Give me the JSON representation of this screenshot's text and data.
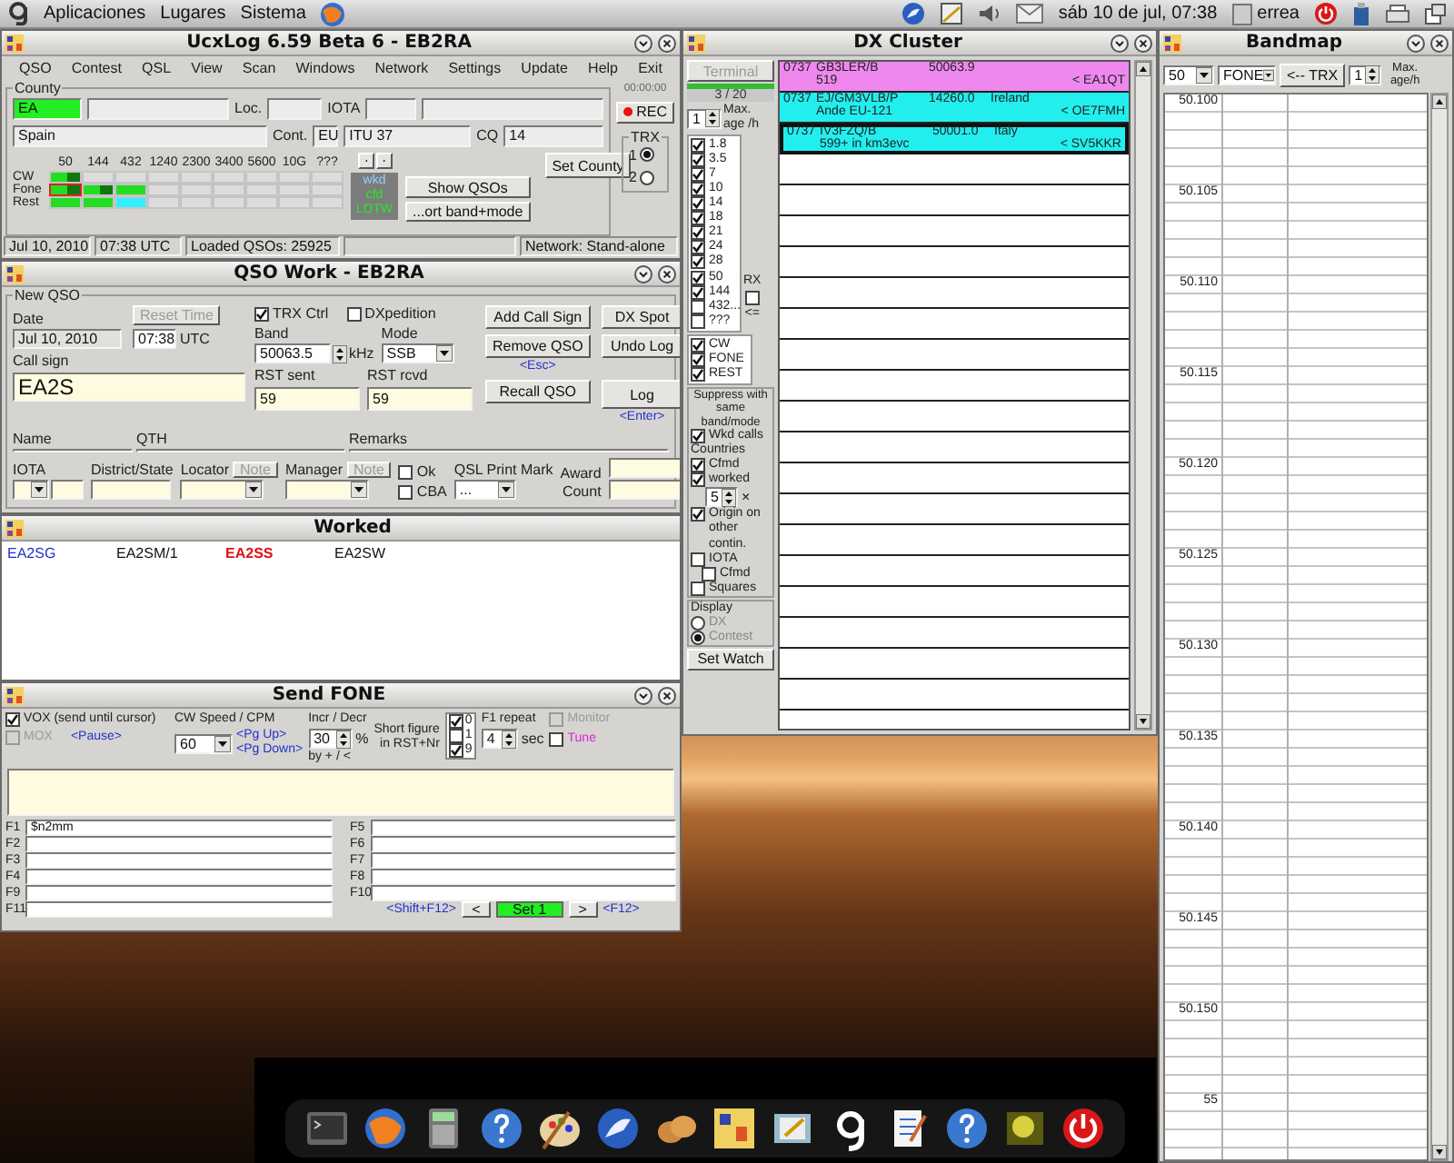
{
  "top_panel": {
    "menus": [
      "Aplicaciones",
      "Lugares",
      "Sistema"
    ],
    "clock": "sáb 10 de jul, 07:38",
    "user": "errea"
  },
  "main_window": {
    "title": "UcxLog 6.59 Beta 6 - EB2RA",
    "menu": [
      "QSO",
      "Contest",
      "QSL",
      "View",
      "Scan",
      "Windows",
      "Network",
      "Settings",
      "Update",
      "Help",
      "Exit"
    ],
    "country_group": {
      "legend": "County",
      "prefix": "EA",
      "loc_label": "Loc.",
      "iota_label": "IOTA",
      "country": "Spain",
      "cont_label": "Cont.",
      "cont": "EU",
      "itu": "ITU 37",
      "cq_label": "CQ",
      "cq": "14"
    },
    "band_grid": {
      "bands": [
        "50",
        "144",
        "432",
        "1240",
        "2300",
        "3400",
        "5600",
        "10G",
        "???"
      ],
      "rows": [
        {
          "mode": "CW",
          "cells": [
            {
              "kind": "both",
              "selected": false
            },
            {
              "kind": "none",
              "selected": false
            },
            {
              "kind": "none",
              "selected": false
            },
            {
              "kind": "none",
              "selected": false
            },
            {
              "kind": "none",
              "selected": false
            },
            {
              "kind": "none",
              "selected": false
            },
            {
              "kind": "none",
              "selected": false
            },
            {
              "kind": "none",
              "selected": false
            },
            {
              "kind": "none",
              "selected": false
            }
          ]
        },
        {
          "mode": "Fone",
          "cells": [
            {
              "kind": "both",
              "selected": true
            },
            {
              "kind": "both",
              "selected": false
            },
            {
              "kind": "cfm",
              "selected": false
            },
            {
              "kind": "none",
              "selected": false
            },
            {
              "kind": "none",
              "selected": false
            },
            {
              "kind": "none",
              "selected": false
            },
            {
              "kind": "none",
              "selected": false
            },
            {
              "kind": "none",
              "selected": false
            },
            {
              "kind": "none",
              "selected": false
            }
          ]
        },
        {
          "mode": "Rest",
          "cells": [
            {
              "kind": "cfm",
              "selected": false
            },
            {
              "kind": "cfm",
              "selected": false
            },
            {
              "kind": "lotw",
              "selected": false
            },
            {
              "kind": "none",
              "selected": false
            },
            {
              "kind": "none",
              "selected": false
            },
            {
              "kind": "none",
              "selected": false
            },
            {
              "kind": "none",
              "selected": false
            },
            {
              "kind": "none",
              "selected": false
            },
            {
              "kind": "none",
              "selected": false
            }
          ]
        }
      ]
    },
    "legend_box": [
      "wkd",
      "cfd",
      "LOTW"
    ],
    "set_country": "Set County",
    "show_qsos": "Show QSOs",
    "sort": "...ort band+mode",
    "timer": "00:00:00",
    "rec": "REC",
    "trx": {
      "label": "TRX",
      "options": [
        {
          "label": "1",
          "selected": true
        },
        {
          "label": "2",
          "selected": false
        }
      ]
    },
    "status_bar": [
      "Jul 10, 2010",
      "07:38 UTC",
      "Loaded QSOs: 25925",
      "Network: Stand-alone"
    ]
  },
  "qso_work": {
    "title": "QSO Work - EB2RA",
    "group": "New QSO",
    "date_label": "Date",
    "date": "Jul 10, 2010",
    "reset_time": {
      "label": "Reset Time",
      "disabled": true
    },
    "time": "07:38",
    "utc": "UTC",
    "trx_ctrl": {
      "label": "TRX Ctrl",
      "checked": true
    },
    "dxpedition": {
      "label": "DXpedition",
      "checked": false
    },
    "band_label": "Band",
    "band": "50063.5",
    "khz": "kHz",
    "mode_label": "Mode",
    "mode": "SSB",
    "callsign_label": "Call sign",
    "callsign": "EA2S",
    "rst_sent_label": "RST sent",
    "rst_sent": "59",
    "rst_rcvd_label": "RST rcvd",
    "rst_rcvd": "59",
    "buttons": [
      "Add Call Sign",
      "DX Spot",
      "Remove QSO",
      "Undo Log",
      "Recall QSO",
      "Log"
    ],
    "esc_hint": "<Esc>",
    "enter_hint": "<Enter>",
    "name_label": "Name",
    "qth_label": "QTH",
    "remarks_label": "Remarks",
    "iota_label": "IOTA",
    "district_label": "District/State",
    "locator_label": "Locator",
    "manager_label": "Manager",
    "locator_note": "Note",
    "manager_note": "Note",
    "ok": {
      "label": "Ok",
      "checked": false
    },
    "cba": {
      "label": "CBA",
      "checked": false
    },
    "qsl_label": "QSL Print Mark",
    "qsl_value": "...",
    "award_label": "Award",
    "count_label": "Count"
  },
  "worked": {
    "title": "Worked",
    "calls": [
      {
        "call": "EA2SG",
        "color": "#2233cc",
        "bold": false
      },
      {
        "call": "EA2SM/1",
        "color": "#111111",
        "bold": false
      },
      {
        "call": "EA2SS",
        "color": "#dd1111",
        "bold": true
      },
      {
        "call": "EA2SW",
        "color": "#111111",
        "bold": false
      }
    ]
  },
  "send_fone": {
    "title": "Send FONE",
    "vox": {
      "label": "VOX (send until cursor)",
      "checked": true
    },
    "pause": "<Pause>",
    "mox": {
      "label": "MOX",
      "checked": false,
      "disabled": true
    },
    "cw_speed_label": "CW Speed / CPM",
    "cw_speed": "60",
    "pg_up": "<Pg Up>",
    "pg_down": "<Pg Down>",
    "incr_label": "Incr / Decr",
    "incr": "30",
    "percent": "%",
    "incr_hint": "by + / <",
    "short_label": "Short figure",
    "short_label_2": "in RST+Nr",
    "short_figures": [
      {
        "label": "0",
        "checked": true
      },
      {
        "label": "1",
        "checked": false
      },
      {
        "label": "9",
        "checked": true
      }
    ],
    "repeat_label": "F1 repeat",
    "repeat": "4",
    "sec": "sec",
    "monitor": {
      "label": "Monitor",
      "checked": false,
      "disabled": true
    },
    "tune": {
      "label": "Tune",
      "checked": false
    },
    "fkeys": [
      {
        "key": "F1",
        "value": "$n2mm"
      },
      {
        "key": "F5"
      },
      {
        "key": "F2"
      },
      {
        "key": "F6"
      },
      {
        "key": "F3"
      },
      {
        "key": "F7"
      },
      {
        "key": "F4"
      },
      {
        "key": "F8"
      },
      {
        "key": "F9"
      },
      {
        "key": "F10"
      },
      {
        "key": "F11"
      }
    ],
    "prev_hint": "<Shift+F12>",
    "prev": "<",
    "set": "Set 1",
    "next": ">",
    "next_hint": "<F12>"
  },
  "dx_cluster": {
    "title": "DX Cluster",
    "terminal": {
      "label": "Terminal",
      "disabled": true
    },
    "count": "3 / 20",
    "max_age": "1",
    "max_age_label": "Max. age /h",
    "bands": [
      {
        "label": "1.8",
        "checked": true
      },
      {
        "label": "3.5",
        "checked": true
      },
      {
        "label": "7",
        "checked": true
      },
      {
        "label": "10",
        "checked": true
      },
      {
        "label": "14",
        "checked": true
      },
      {
        "label": "18",
        "checked": true
      },
      {
        "label": "21",
        "checked": true
      },
      {
        "label": "24",
        "checked": true
      },
      {
        "label": "28",
        "checked": true
      },
      {
        "label": "50",
        "checked": true
      },
      {
        "label": "144",
        "checked": true
      },
      {
        "label": "432...",
        "checked": false
      },
      {
        "label": "???",
        "checked": false
      }
    ],
    "rx_label": "RX",
    "rx_checked": false,
    "rx_hint": "<=",
    "modes": [
      {
        "label": "CW",
        "checked": true
      },
      {
        "label": "FONE",
        "checked": true
      },
      {
        "label": "REST",
        "checked": true
      }
    ],
    "suppress_label": "Suppress with same band/mode",
    "wkd_calls": {
      "label": "Wkd calls",
      "checked": true
    },
    "countries_label": "Countries",
    "cfmd": {
      "label": "Cfmd",
      "checked": true
    },
    "worked": {
      "label": "worked",
      "checked": true
    },
    "worked_count": "5",
    "times": "×",
    "origin": {
      "label": "Origin on other contin.",
      "checked": true
    },
    "iota": {
      "label": "IOTA",
      "checked": false
    },
    "iota_cfmd": {
      "label": "Cfmd",
      "checked": false
    },
    "squares": {
      "label": "Squares",
      "checked": false
    },
    "display_label": "Display",
    "display_options": [
      {
        "label": "DX",
        "selected": false
      },
      {
        "label": "Contest",
        "selected": true
      }
    ],
    "set_watch": "Set Watch",
    "spots": [
      {
        "time": "0737",
        "call": "GB3LER/B",
        "freq": "50063.9",
        "comment": "519",
        "spotter": "< EA1QT",
        "color": "#ee88ee",
        "selected": false
      },
      {
        "time": "0737",
        "call": "EJ/GM3VLB/P",
        "freq": "14260.0",
        "country": "Ireland",
        "comment": "Ande EU-121",
        "spotter": "< OE7FMH",
        "color": "#22eeee",
        "selected": false
      },
      {
        "time": "0737",
        "call": "IV3FZQ/B",
        "freq": "50001.0",
        "country": "Italy",
        "comment": "599+ in km3evc",
        "spotter": "< SV5KKR",
        "color": "#22eeee",
        "selected": true
      }
    ]
  },
  "bandmap": {
    "title": "Bandmap",
    "band": "50",
    "mode": "FONE",
    "trx_button": "<-- TRX",
    "max_age": "1",
    "max_age_label": "Max. age/h",
    "freqs": [
      "50.100",
      "50.105",
      "50.110",
      "50.115",
      "50.120",
      "50.125",
      "50.130",
      "50.135",
      "50.140",
      "50.145",
      "50.150",
      "55"
    ]
  }
}
